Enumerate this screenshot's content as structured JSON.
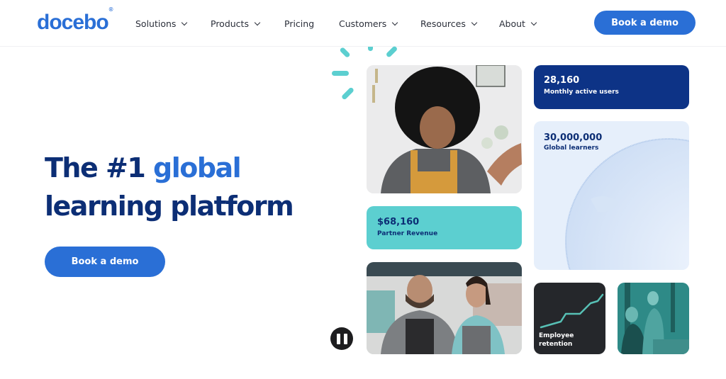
{
  "nav": {
    "logo": "docebo",
    "logo_mark": "®",
    "items": [
      {
        "label": "Solutions",
        "has_dropdown": true
      },
      {
        "label": "Products",
        "has_dropdown": true
      },
      {
        "label": "Pricing",
        "has_dropdown": false
      },
      {
        "label": "Customers",
        "has_dropdown": true
      },
      {
        "label": "Resources",
        "has_dropdown": true
      },
      {
        "label": "About",
        "has_dropdown": true
      }
    ],
    "cta_label": "Book a demo"
  },
  "hero": {
    "title_part1": "The #1 ",
    "title_accent": "global",
    "title_line2": "learning platform",
    "cta_label": "Book a demo"
  },
  "stats": {
    "monthly_active": {
      "value": "28,160",
      "label": "Monthly active users"
    },
    "global_learners": {
      "value": "30,000,000",
      "label": "Global learners"
    },
    "partner_revenue": {
      "value": "$68,160",
      "label": "Partner Revenue"
    },
    "employee_retention": {
      "label_line1": "Employee",
      "label_line2": "retention"
    }
  },
  "media": {
    "pause_control": "pause-icon"
  },
  "colors": {
    "brand_blue": "#2a6fd6",
    "navy": "#0c2e75",
    "teal": "#5ccfd0",
    "card_dark_blue": "#0d3386",
    "card_light_blue": "#e6effb",
    "card_dark": "#25272b"
  }
}
